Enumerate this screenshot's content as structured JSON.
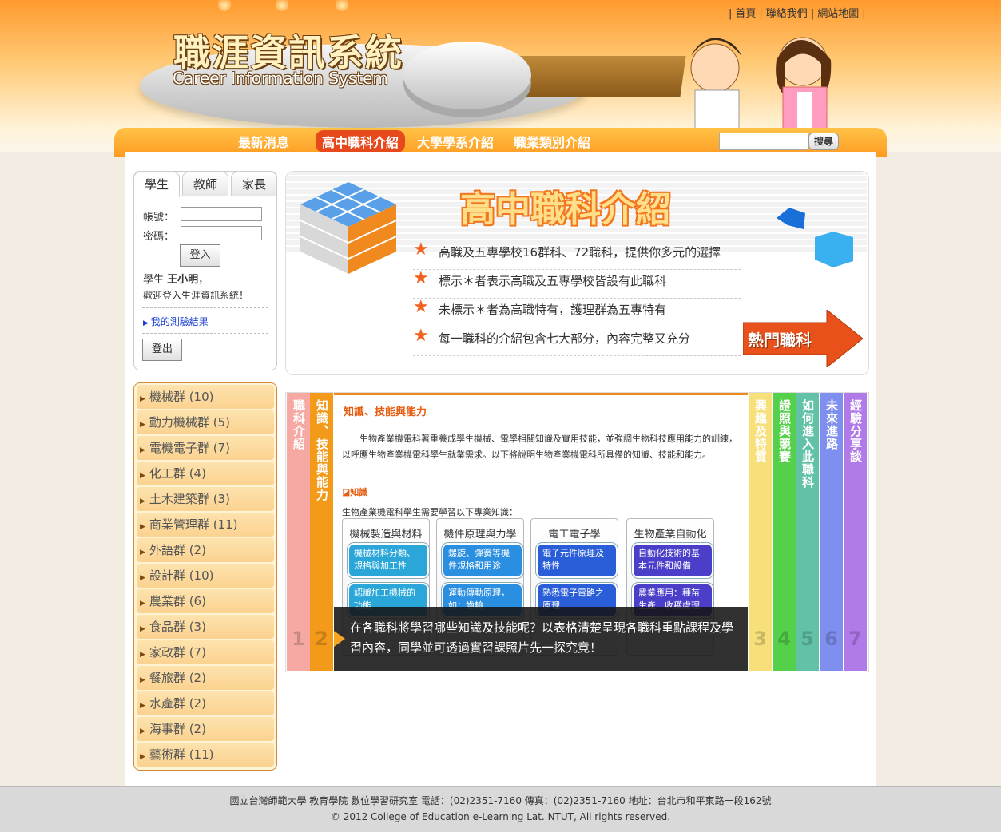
{
  "header": {
    "logo_title": "職涯資訊系統",
    "logo_subtitle": "Career Information System",
    "top_links": [
      "首頁",
      "聯絡我們",
      "網站地圖"
    ],
    "separator": "|"
  },
  "nav": {
    "items": [
      "最新消息",
      "高中職科介紹",
      "大學學系介紹",
      "職業類別介紹"
    ],
    "active_index": 1,
    "search_button": "搜尋",
    "search_value": ""
  },
  "login": {
    "tabs": [
      "學生",
      "教師",
      "家長"
    ],
    "active_tab": 0,
    "account_label": "帳號：",
    "password_label": "密碼：",
    "login_button": "登入",
    "greeting_line1_prefix": "學生 ",
    "user_name": "王小明",
    "greeting_line1_suffix": "，",
    "greeting_line2": "歡迎登入生涯資訊系統！",
    "test_results_link": "我的測驗結果",
    "logout_button": "登出"
  },
  "categories": [
    "機械群 (10)",
    "動力機械群 (5)",
    "電機電子群 (7)",
    "化工群 (4)",
    "土木建築群 (3)",
    "商業管理群 (11)",
    "外語群 (2)",
    "設計群 (10)",
    "農業群 (6)",
    "食品群 (3)",
    "家政群 (7)",
    "餐旅群 (2)",
    "水產群 (2)",
    "海事群 (2)",
    "藝術群 (11)"
  ],
  "banner": {
    "title": "高中職科介紹",
    "lines": [
      "高職及五專學校16群科、72職科，提供你多元的選擇",
      "標示＊者表示高職及五專學校皆設有此職科",
      "未標示＊者為高職特有，護理群為五專特有",
      "每一職科的介紹包含七大部分，內容完整又充分"
    ],
    "hot_button": "熱門職科"
  },
  "panel": {
    "tabs": [
      {
        "label": "職科介紹",
        "num": "1",
        "color": "#f6a9a2"
      },
      {
        "label": "知識、技能與能力",
        "num": "2",
        "color": "#f39a1a"
      },
      {
        "label": "興趣及特質",
        "num": "3",
        "color": "#f7e07a"
      },
      {
        "label": "證照與競賽",
        "num": "4",
        "color": "#55d04a"
      },
      {
        "label": "如何進入此職科",
        "num": "5",
        "color": "#62c2a8"
      },
      {
        "label": "未來進路",
        "num": "6",
        "color": "#7f8ff0"
      },
      {
        "label": "經驗分享談",
        "num": "7",
        "color": "#b07ae8"
      }
    ],
    "section_title": "知識、技能與能力",
    "intro": "生物產業機電科著重養成學生機械、電學相關知識及實用技能，並強調生物科技應用能力的訓練，以呼應生物產業機電科學生就業需求。以下將說明生物產業機電科所具備的知識、技能和能力。",
    "knowledge_heading": "知識",
    "knowledge_sub": "生物產業機電科學生需要學習以下專業知識：",
    "columns": [
      {
        "title": "機械製造與材料",
        "items": [
          "機械材料分類、規格與加工性",
          "認識加工機械的功能"
        ],
        "color": "#2aa7d8"
      },
      {
        "title": "機件原理與力學",
        "items": [
          "螺旋、彈簧等機件規格和用途",
          "運動傳動原理，如：齒輪"
        ],
        "color": "#2a8fe0"
      },
      {
        "title": "電工電子學",
        "items": [
          "電子元件原理及特性",
          "熟悉電子電路之原理"
        ],
        "color": "#2a5ed8"
      },
      {
        "title": "生物產業自動化",
        "items": [
          "自動化技術的基本元件和設備",
          "農業應用：種苗生產、收穫處理"
        ],
        "color": "#4b3ec8"
      }
    ],
    "caption": "在各職科將學習哪些知識及技能呢？以表格清楚呈現各職科重點課程及學習內容，同學並可透過實習課照片先一探究竟！"
  },
  "footer": {
    "line1": "國立台灣師範大學 教育學院 數位學習研究室 電話：(02)2351-7160 傳真：(02)2351-7160 地址：台北市和平東路一段162號",
    "line2": "© 2012 College of Education e-Learning Lat. NTUT, All rights reserved."
  }
}
